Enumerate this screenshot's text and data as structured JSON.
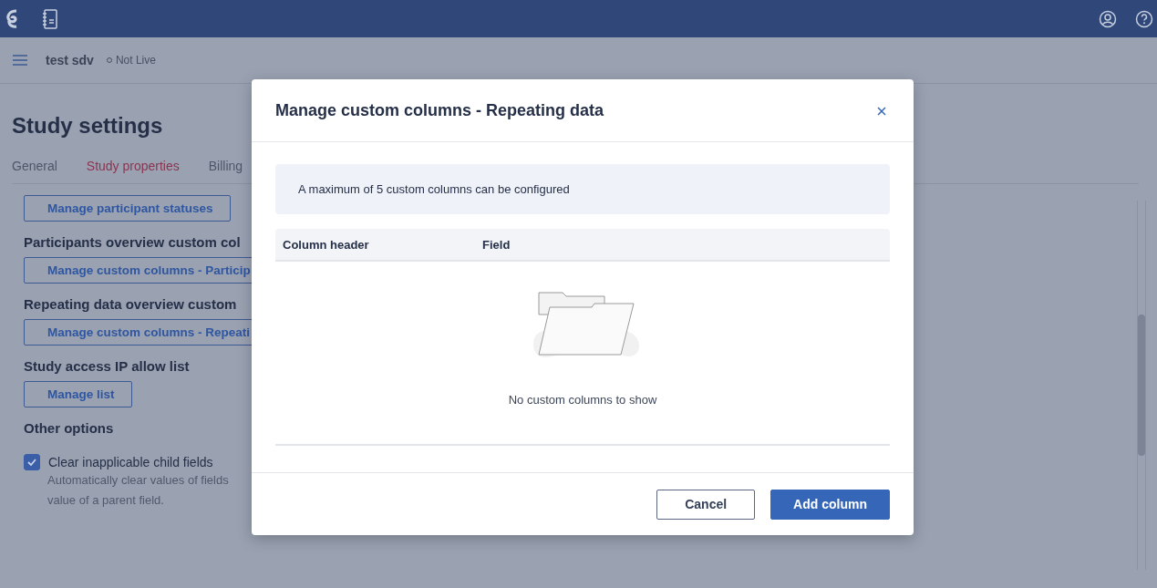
{
  "study": {
    "name": "test sdv",
    "status": "Not Live"
  },
  "page": {
    "title": "Study settings",
    "tabs": [
      {
        "label": "General",
        "selected": false
      },
      {
        "label": "Study properties",
        "selected": true
      },
      {
        "label": "Billing",
        "selected": false
      }
    ]
  },
  "sections": [
    {
      "kind": "button",
      "button": "Manage participant statuses"
    },
    {
      "kind": "heading",
      "text": "Participants overview custom col"
    },
    {
      "kind": "button",
      "button": "Manage custom columns - Particip"
    },
    {
      "kind": "heading",
      "text": "Repeating data overview custom"
    },
    {
      "kind": "button",
      "button": "Manage custom columns - Repeati"
    },
    {
      "kind": "heading",
      "text": "Study access IP allow list"
    },
    {
      "kind": "button",
      "button": "Manage list"
    },
    {
      "kind": "heading",
      "text": "Other options"
    },
    {
      "kind": "checkbox",
      "label": "Clear inapplicable child fields",
      "checked": true,
      "description": [
        "Automatically clear values of fields",
        "value of a parent field."
      ]
    }
  ],
  "dialog": {
    "title": "Manage custom columns - Repeating data",
    "notice": "A maximum of 5 custom columns can be configured",
    "table": {
      "columns": [
        "Column header",
        "Field"
      ],
      "empty_text": "No custom columns to show"
    },
    "buttons": [
      {
        "label": "Cancel",
        "kind": "secondary"
      },
      {
        "label": "Add column",
        "kind": "primary"
      }
    ]
  }
}
